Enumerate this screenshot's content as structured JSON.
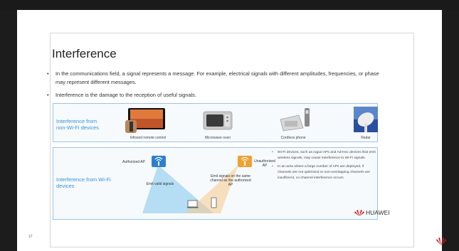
{
  "slide": {
    "title": "Interference",
    "page_number": "17",
    "bullets": [
      "In the communications field, a signal represents a message. For example, electrical signals with different amplitudes, frequencies, or phase may represent different messages.",
      "Interference is the damage to the reception of useful signals."
    ],
    "non_wifi": {
      "label": "Interference from non-Wi-Fi devices",
      "devices": [
        {
          "caption": "Infrared remote control",
          "icon": "tv-remote-icon"
        },
        {
          "caption": "Microwave oven",
          "icon": "microwave-icon"
        },
        {
          "caption": "Cordless phone",
          "icon": "cordless-phone-icon"
        },
        {
          "caption": "Radar",
          "icon": "radar-icon"
        }
      ]
    },
    "wifi": {
      "label": "Interference from Wi-Fi devices",
      "authorized_ap": "Authorized AP",
      "unauthorized_ap": "Unauthorized AP",
      "emit_valid": "Emit valid signals",
      "emit_same_channel": "Emit signals on the same channel as the authorized AP",
      "notes": [
        "Wi-Fi devices, such as rogue APs and Ad-Hoc devices that emit wireless signals, may cause interference to Wi-Fi signals.",
        "In an area where a large number of APs are deployed, if channels are not optimized or non-overlapping channels are insufficient, co-channel interference occurs."
      ]
    },
    "brand": "HUAWEI",
    "colors": {
      "accent_blue": "#3a8fd6",
      "ap_blue": "#2f7fd0",
      "ap_orange": "#f0a030",
      "brand_red": "#d21e1e"
    }
  }
}
